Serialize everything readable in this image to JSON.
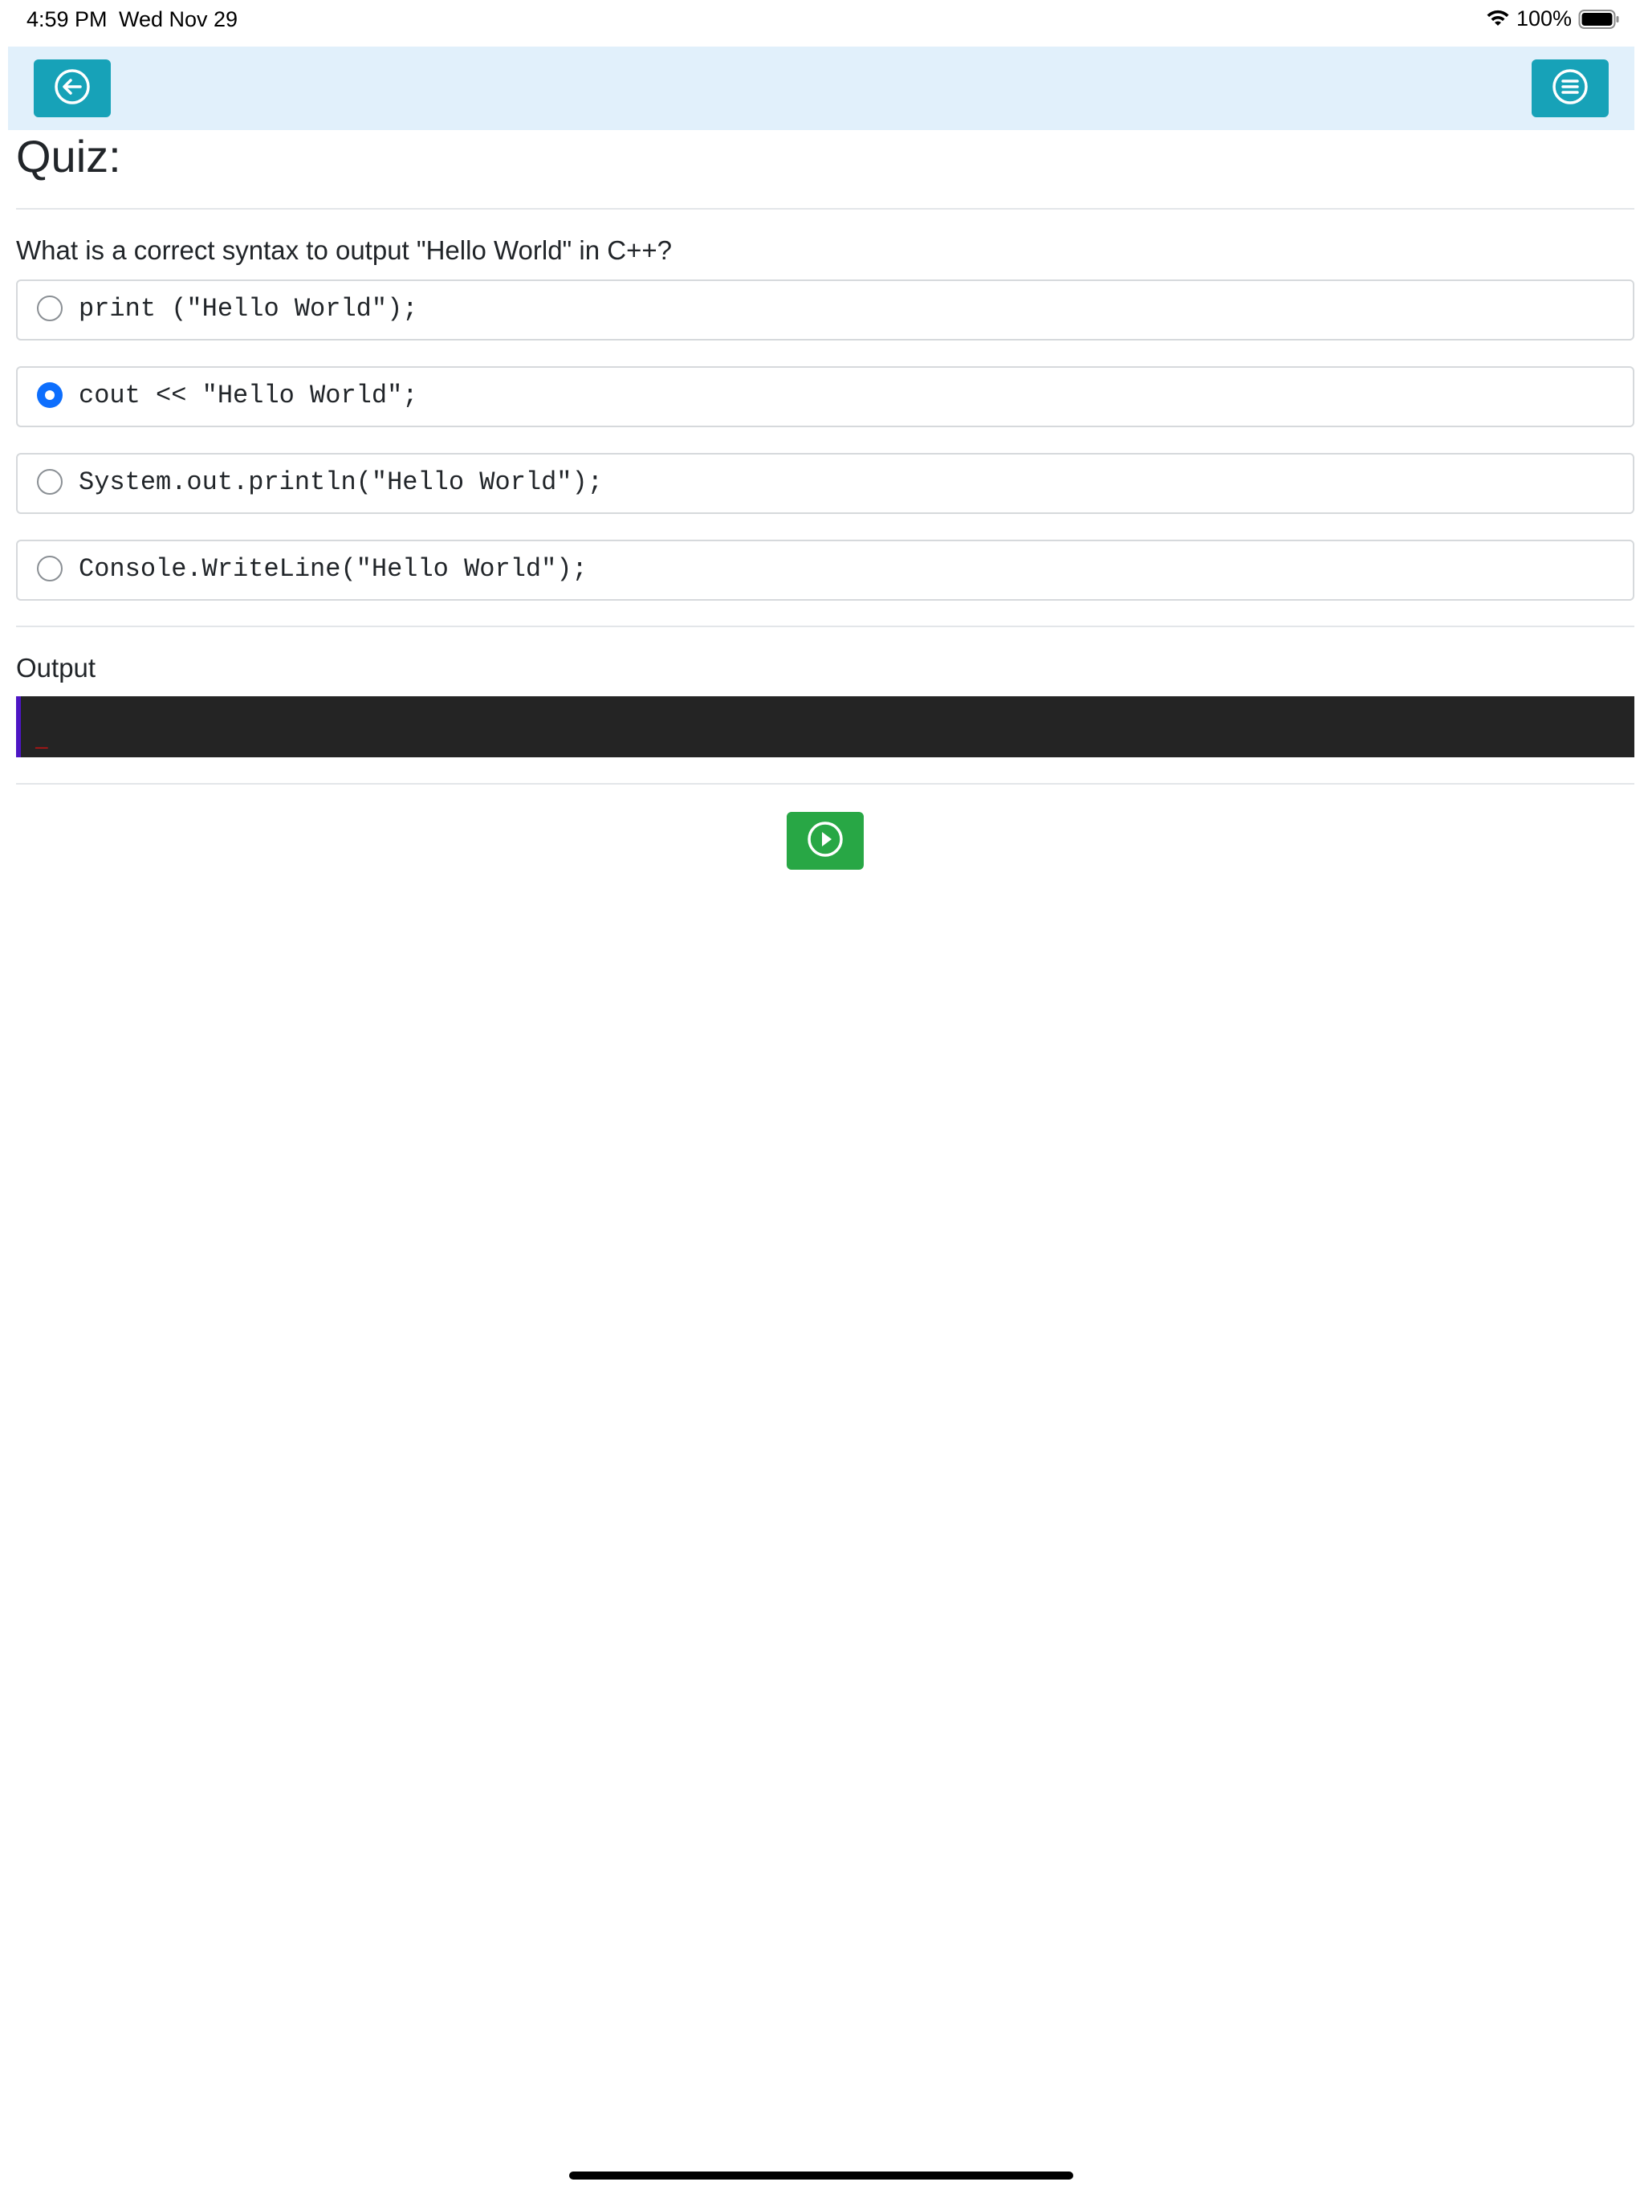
{
  "status_bar": {
    "time": "4:59 PM",
    "date": "Wed Nov 29",
    "battery": "100%",
    "icons": [
      "wifi-icon",
      "battery-icon"
    ]
  },
  "nav": {
    "back_icon": "arrow-left-circle-icon",
    "menu_icon": "list-circle-icon",
    "accent_color": "#17a2b8",
    "background_color": "#e1f0fb"
  },
  "quiz": {
    "title": "Quiz:",
    "question": "What is a correct syntax to output \"Hello World\" in C++?",
    "options": [
      {
        "code": "print (\"Hello World\");",
        "selected": false
      },
      {
        "code": "cout << \"Hello World\";",
        "selected": true
      },
      {
        "code": "System.out.println(\"Hello World\");",
        "selected": false
      },
      {
        "code": "Console.WriteLine(\"Hello World\");",
        "selected": false
      }
    ]
  },
  "output": {
    "label": "Output",
    "content": "_"
  },
  "run_button": {
    "icon": "play-circle-icon",
    "color": "#28a745"
  }
}
